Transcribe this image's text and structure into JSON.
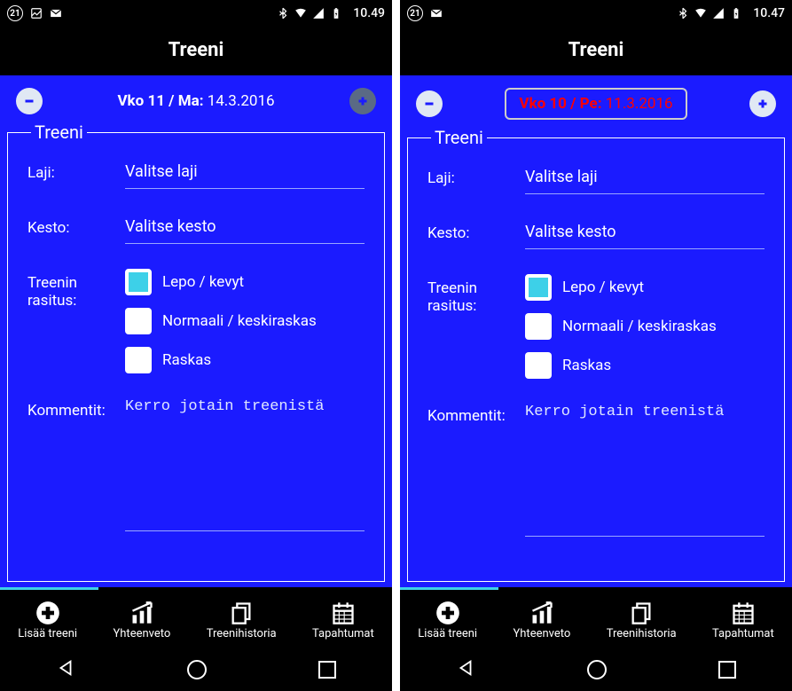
{
  "left": {
    "status": {
      "badge": "21",
      "clock": "10.49"
    },
    "title": "Treeni",
    "date": {
      "prefix": "Vko 11 / Ma:",
      "value": "14.3.2016"
    },
    "legend": "Treeni",
    "labels": {
      "laji": "Laji:",
      "kesto": "Kesto:",
      "rasitus_line1": "Treenin",
      "rasitus_line2": "rasitus:",
      "kommentit": "Kommentit:"
    },
    "fields": {
      "laji_placeholder": "Valitse laji",
      "kesto_placeholder": "Valitse kesto",
      "kommentit_placeholder": "Kerro jotain treenistä"
    },
    "rasitus_options": {
      "lepo": "Lepo / kevyt",
      "normaali": "Normaali / keskiraskas",
      "raskas": "Raskas"
    },
    "tabs": {
      "lisaa": "Lisää treeni",
      "yhteenveto": "Yhteenveto",
      "historia": "Treenihistoria",
      "tapahtumat": "Tapahtumat"
    }
  },
  "right": {
    "status": {
      "badge": "21",
      "clock": "10.47"
    },
    "title": "Treeni",
    "date": {
      "prefix": "Vko 10 / Pe:",
      "value": "11.3.2016"
    },
    "legend": "Treeni",
    "labels": {
      "laji": "Laji:",
      "kesto": "Kesto:",
      "rasitus_line1": "Treenin",
      "rasitus_line2": "rasitus:",
      "kommentit": "Kommentit:"
    },
    "fields": {
      "laji_placeholder": "Valitse laji",
      "kesto_placeholder": "Valitse kesto",
      "kommentit_placeholder": "Kerro jotain treenistä"
    },
    "rasitus_options": {
      "lepo": "Lepo / kevyt",
      "normaali": "Normaali / keskiraskas",
      "raskas": "Raskas"
    },
    "tabs": {
      "lisaa": "Lisää treeni",
      "yhteenveto": "Yhteenveto",
      "historia": "Treenihistoria",
      "tapahtumat": "Tapahtumat"
    }
  }
}
